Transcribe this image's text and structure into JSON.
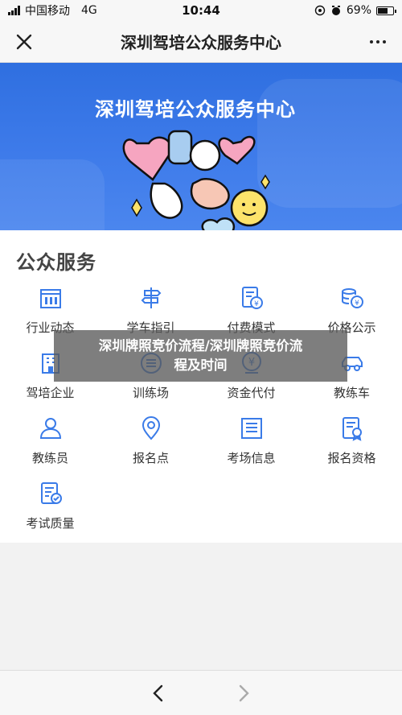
{
  "status_bar": {
    "carrier": "中国移动",
    "network": "4G",
    "time": "10:44",
    "battery": "69%",
    "battery_level": 0.69
  },
  "nav": {
    "title": "深圳驾培公众服务中心"
  },
  "banner": {
    "title": "深圳驾培公众服务中心"
  },
  "services": {
    "section_title": "公众服务",
    "items": [
      {
        "label": "行业动态",
        "icon": "building-icon"
      },
      {
        "label": "学车指引",
        "icon": "signpost-icon"
      },
      {
        "label": "付费模式",
        "icon": "payment-document-icon"
      },
      {
        "label": "价格公示",
        "icon": "price-coins-icon"
      },
      {
        "label": "驾培企业",
        "icon": "enterprise-building-icon"
      },
      {
        "label": "训练场",
        "icon": "training-ground-icon"
      },
      {
        "label": "资金代付",
        "icon": "fund-payment-icon"
      },
      {
        "label": "教练车",
        "icon": "car-icon"
      },
      {
        "label": "教练员",
        "icon": "person-icon"
      },
      {
        "label": "报名点",
        "icon": "location-pin-icon"
      },
      {
        "label": "考场信息",
        "icon": "list-document-icon"
      },
      {
        "label": "报名资格",
        "icon": "certificate-icon"
      },
      {
        "label": "考试质量",
        "icon": "checklist-icon"
      }
    ]
  },
  "overlay": {
    "line1": "深圳牌照竞价流程/深圳牌照竞价流",
    "line2": "程及时间"
  },
  "colors": {
    "accent": "#3a7be8",
    "banner": "#3573e4"
  }
}
